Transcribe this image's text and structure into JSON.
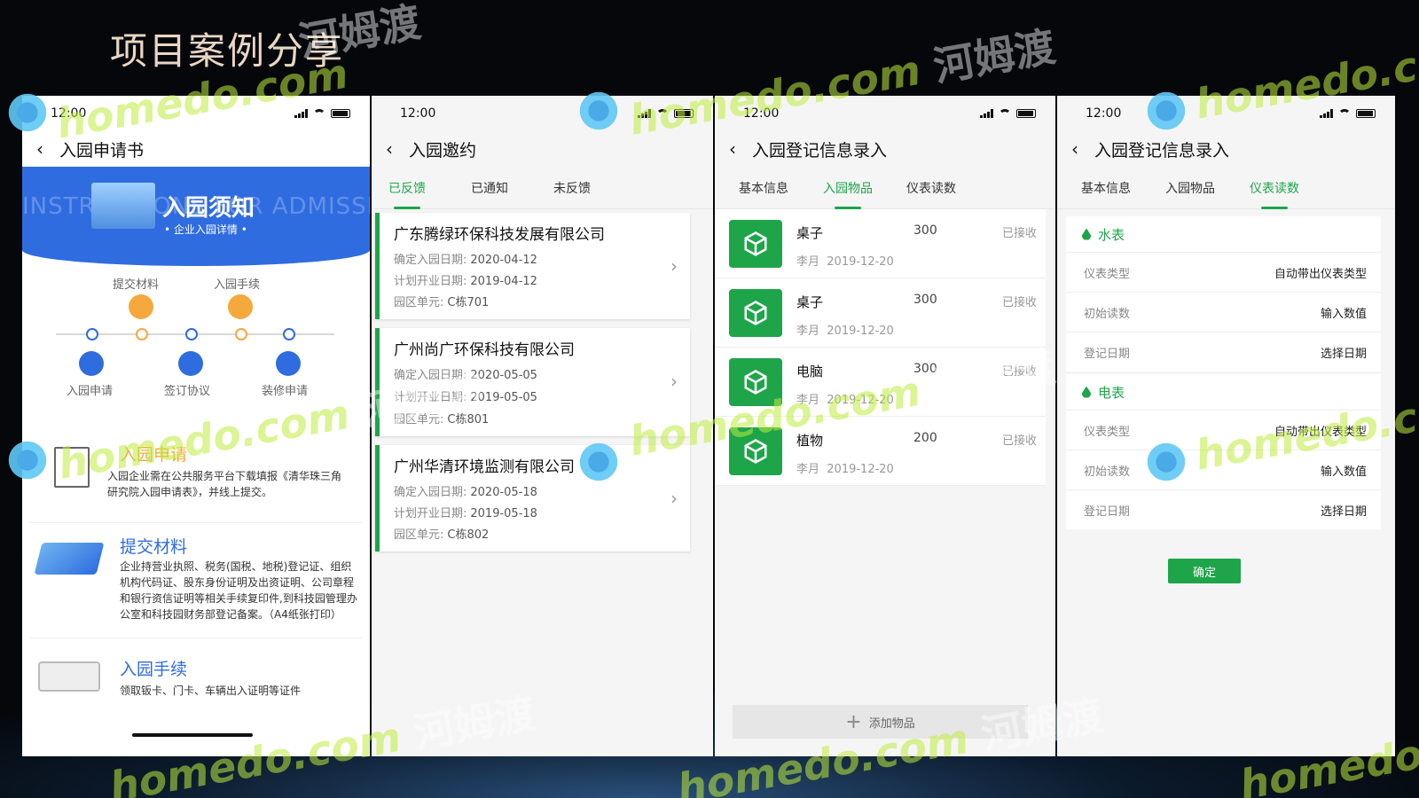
{
  "slide_title": "项目案例分享",
  "status_time": "12:00",
  "watermark": {
    "brand": "homedo.com",
    "cn": "河姆渡"
  },
  "colors": {
    "accent": "#1ea54a",
    "banner": "#2f6ce0",
    "step_orange": "#f5a93c",
    "step_blue": "#2f6ce0"
  },
  "phone1": {
    "title": "入园申请书",
    "banner": {
      "bg_text": "INSTRUCTIONS FOR ADMISSION",
      "title": "入园须知",
      "subtitle": "• 企业入园详情 •"
    },
    "steps_top": [
      "提交材料",
      "入园手续"
    ],
    "steps_bottom": [
      "入园申请",
      "签订协议",
      "装修申请"
    ],
    "sections": [
      {
        "title": "入园申请",
        "desc": "入园企业需在公共服务平台下载填报《清华珠三角研究院入园申请表》，并线上提交。"
      },
      {
        "title": "提交材料",
        "desc": "企业持营业执照、税务(国税、地税)登记证、组织机构代码证、股东身份证明及出资证明、公司章程和银行资信证明等相关手续复印件,到科技园管理办公室和科技园财务部登记备案。（A4纸张打印）"
      },
      {
        "title": "入园手续",
        "desc": "领取钣卡、门卡、车辆出入证明等证件"
      }
    ]
  },
  "phone2": {
    "title": "入园邀约",
    "tabs": [
      "已反馈",
      "已通知",
      "未反馈"
    ],
    "cards": [
      {
        "company": "广东腾绿环保科技发展有限公司",
        "l1": "确定入园日期:",
        "d1": "2020-04-12",
        "l2": "计划开业日期:",
        "d2": "2019-04-12",
        "l3": "园区单元:",
        "d3": "C栋701"
      },
      {
        "company": "广州尚广环保科技有限公司",
        "l1": "确定入园日期:",
        "d1": "2020-05-05",
        "l2": "计划开业日期:",
        "d2": "2019-05-05",
        "l3": "园区单元:",
        "d3": "C栋801"
      },
      {
        "company": "广州华清环境监测有限公司",
        "l1": "确定入园日期:",
        "d1": "2020-05-18",
        "l2": "计划开业日期:",
        "d2": "2019-05-18",
        "l3": "园区单元:",
        "d3": "C栋802"
      }
    ]
  },
  "phone3": {
    "title": "入园登记信息录入",
    "tabs": [
      "基本信息",
      "入园物品",
      "仪表读数"
    ],
    "items": [
      {
        "name": "桌子",
        "qty": "300",
        "status": "已接收",
        "person": "李月",
        "date": "2019-12-20"
      },
      {
        "name": "桌子",
        "qty": "300",
        "status": "已接收",
        "person": "李月",
        "date": "2019-12-20"
      },
      {
        "name": "电脑",
        "qty": "300",
        "status": "已接收",
        "person": "李月",
        "date": "2019-12-20"
      },
      {
        "name": "植物",
        "qty": "200",
        "status": "已接收",
        "person": "李月",
        "date": "2019-12-20"
      }
    ],
    "add_label": "添加物品"
  },
  "phone4": {
    "title": "入园登记信息录入",
    "tabs": [
      "基本信息",
      "入园物品",
      "仪表读数"
    ],
    "meters": [
      {
        "name": "水表",
        "rows": [
          {
            "k": "仪表类型",
            "v": "自动带出仪表类型"
          },
          {
            "k": "初始读数",
            "v": "输入数值"
          },
          {
            "k": "登记日期",
            "v": "选择日期"
          }
        ]
      },
      {
        "name": "电表",
        "rows": [
          {
            "k": "仪表类型",
            "v": "自动带出仪表类型"
          },
          {
            "k": "初始读数",
            "v": "输入数值"
          },
          {
            "k": "登记日期",
            "v": "选择日期"
          }
        ]
      }
    ],
    "confirm_label": "确定"
  }
}
